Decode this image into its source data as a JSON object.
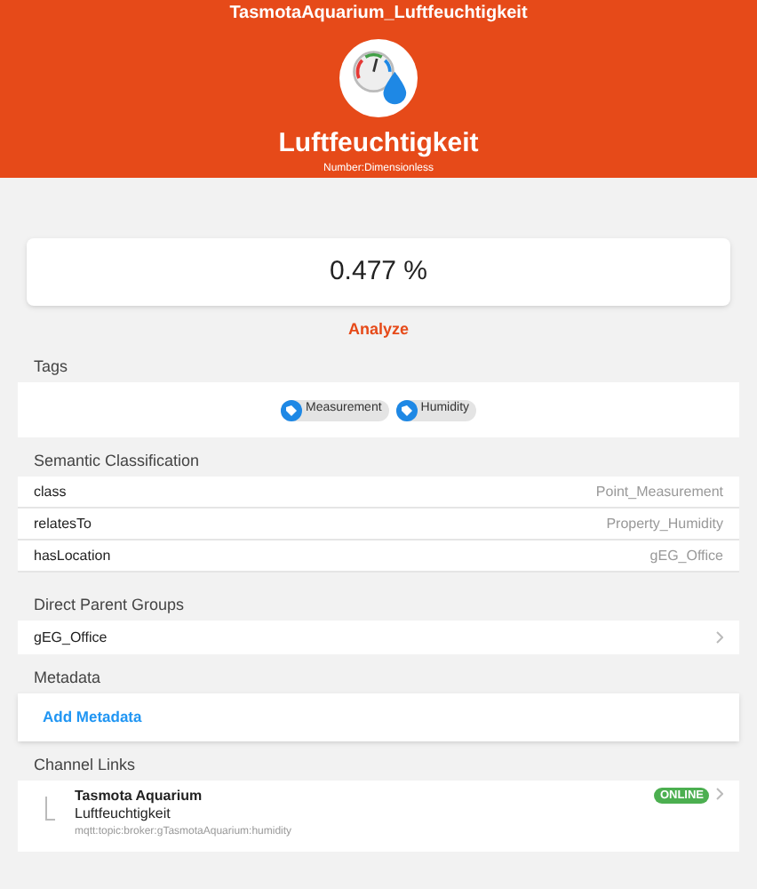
{
  "header": {
    "title": "TasmotaAquarium_Luftfeuchtigkeit",
    "label": "Luftfeuchtigkeit",
    "type": "Number:Dimensionless"
  },
  "state": {
    "value": "0.477 %"
  },
  "analyze": "Analyze",
  "tags": {
    "heading": "Tags",
    "items": [
      "Measurement",
      "Humidity"
    ]
  },
  "semantic": {
    "heading": "Semantic Classification",
    "rows": [
      {
        "key": "class",
        "value": "Point_Measurement"
      },
      {
        "key": "relatesTo",
        "value": "Property_Humidity"
      },
      {
        "key": "hasLocation",
        "value": "gEG_Office"
      }
    ]
  },
  "parent_groups": {
    "heading": "Direct Parent Groups",
    "items": [
      "gEG_Office"
    ]
  },
  "metadata": {
    "heading": "Metadata",
    "action": "Add Metadata"
  },
  "channel_links": {
    "heading": "Channel Links",
    "items": [
      {
        "thing": "Tasmota Aquarium",
        "channel": "Luftfeuchtigkeit",
        "uid": "mqtt:topic:broker:gTasmotaAquarium:humidity",
        "status": "ONLINE",
        "online": true
      }
    ]
  }
}
